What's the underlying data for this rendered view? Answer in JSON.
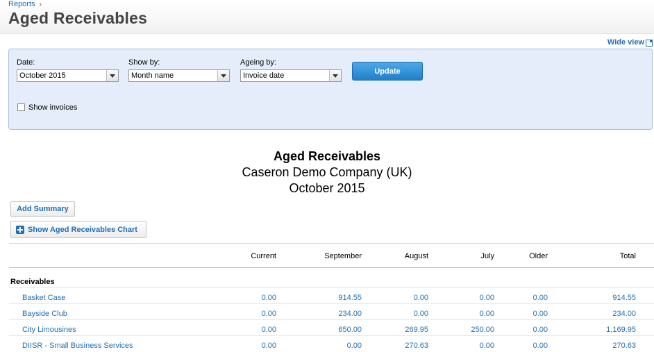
{
  "breadcrumb": {
    "link": "Reports",
    "sep": "›"
  },
  "page_title": "Aged Receivables",
  "wide_view": "Wide view",
  "filters": {
    "date_label": "Date:",
    "date_value": "October 2015",
    "showby_label": "Show by:",
    "showby_value": "Month name",
    "ageing_label": "Ageing by:",
    "ageing_value": "Invoice date",
    "update_label": "Update",
    "show_invoices_label": "Show invoices",
    "show_invoices_checked": false
  },
  "report": {
    "title": "Aged Receivables",
    "company": "Caseron Demo Company (UK)",
    "period": "October 2015"
  },
  "buttons": {
    "add_summary": "Add Summary",
    "show_chart": "Show Aged Receivables Chart"
  },
  "table": {
    "columns": [
      "Current",
      "September",
      "August",
      "July",
      "Older",
      "Total"
    ],
    "group": "Receivables",
    "rows": [
      {
        "name": "Basket Case",
        "values": [
          "0.00",
          "914.55",
          "0.00",
          "0.00",
          "0.00",
          "914.55"
        ]
      },
      {
        "name": "Bayside Club",
        "values": [
          "0.00",
          "234.00",
          "0.00",
          "0.00",
          "0.00",
          "234.00"
        ]
      },
      {
        "name": "City Limousines",
        "values": [
          "0.00",
          "650.00",
          "269.95",
          "250.00",
          "0.00",
          "1,169.95"
        ]
      },
      {
        "name": "DIISR - Small Business Services",
        "values": [
          "0.00",
          "0.00",
          "270.63",
          "0.00",
          "0.00",
          "270.63"
        ]
      }
    ]
  },
  "colors": {
    "link": "#1f6fb5",
    "panel": "#e4edf9",
    "button": "#1e7fcb"
  }
}
